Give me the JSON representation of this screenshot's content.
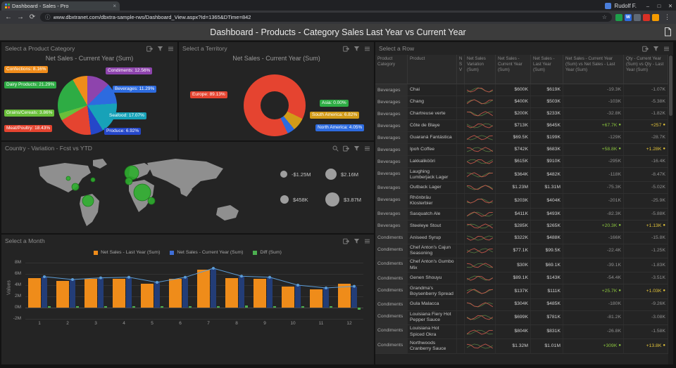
{
  "browser": {
    "tab": {
      "title": "Dashboard - Sales - Pro",
      "close": "×"
    },
    "user": "Rudolf F.",
    "window_controls": [
      "–",
      "□",
      "✕"
    ],
    "nav": {
      "back": "←",
      "forward": "→",
      "reload": "⟳"
    },
    "url": "www.dbxtranet.com/dbxtra-sample-rws/Dashboard_View.aspx?Id=1365&DTime=842",
    "url_info": "ⓘ",
    "star": "☆",
    "menu": "⋮",
    "extensions": [
      {
        "name": "green",
        "color": "#1e9e4a",
        "glyph": ""
      },
      {
        "name": "blue-w",
        "color": "#2d6bdf",
        "glyph": "W"
      },
      {
        "name": "slate",
        "color": "#5f6975",
        "glyph": ""
      },
      {
        "name": "red",
        "color": "#d93025",
        "glyph": ""
      },
      {
        "name": "orange",
        "color": "#f59b00",
        "glyph": ""
      }
    ]
  },
  "header": {
    "title": "Dashboard - Products - Category Sales Last Year vs Current Year"
  },
  "panels": {
    "category": {
      "title": "Select a Product Category",
      "chart_title": "Net Sales - Current Year (Sum)"
    },
    "territory": {
      "title": "Select a Territory",
      "chart_title": "Net Sales - Current Year (Sum)"
    },
    "map": {
      "title": "Country - Variation - Fcst vs YTD"
    },
    "month": {
      "title": "Select a Month"
    },
    "table": {
      "title": "Select a Row"
    }
  },
  "chart_data": [
    {
      "type": "pie",
      "title": "Net Sales - Current Year (Sum)",
      "slices": [
        {
          "name": "Condiments",
          "value": 12.56,
          "color": "#8e44ad"
        },
        {
          "name": "Beverages",
          "value": 11.29,
          "color": "#2d6bdf"
        },
        {
          "name": "Seafood",
          "value": 17.07,
          "color": "#17a2b8"
        },
        {
          "name": "Produce",
          "value": 6.92,
          "color": "#2547c9"
        },
        {
          "name": "Meat/Poultry",
          "value": 18.43,
          "color": "#e54430"
        },
        {
          "name": "Grains/Cereals",
          "value": 3.86,
          "color": "#6abf3a"
        },
        {
          "name": "Dairy Products",
          "value": 21.29,
          "color": "#2eac44"
        },
        {
          "name": "Confections",
          "value": 8.16,
          "color": "#ef8c1a"
        }
      ]
    },
    {
      "type": "pie",
      "subtype": "donut",
      "title": "Net Sales - Current Year (Sum)",
      "slices": [
        {
          "name": "Europe",
          "value": 89.13,
          "color": "#e54430"
        },
        {
          "name": "Asia",
          "value": 0.0,
          "color": "#2eac44"
        },
        {
          "name": "South America",
          "value": 6.82,
          "color": "#d29b18"
        },
        {
          "name": "North America",
          "value": 4.05,
          "color": "#2d6bdf"
        }
      ]
    },
    {
      "type": "scatter",
      "subtype": "bubble-map",
      "title": "Country - Variation - Fcst vs YTD",
      "legend": [
        {
          "label": "-$1.25M",
          "size": 10
        },
        {
          "label": "$2.16M",
          "size": 16
        },
        {
          "label": "$458K",
          "size": 12
        },
        {
          "label": "$3.87M",
          "size": 20
        }
      ],
      "bubbles": [
        {
          "x": 60,
          "y": 30,
          "r": 3
        },
        {
          "x": 70,
          "y": 42,
          "r": 5
        },
        {
          "x": 88,
          "y": 62,
          "r": 8
        },
        {
          "x": 150,
          "y": 22,
          "r": 10
        },
        {
          "x": 146,
          "y": 34,
          "r": 5
        },
        {
          "x": 165,
          "y": 50,
          "r": 12
        },
        {
          "x": 178,
          "y": 62,
          "r": 5
        },
        {
          "x": 95,
          "y": 32,
          "r": 3
        }
      ]
    },
    {
      "type": "bar",
      "categories": [
        "1",
        "2",
        "3",
        "4",
        "5",
        "6",
        "7",
        "8",
        "9",
        "10",
        "11",
        "12"
      ],
      "series": [
        {
          "name": "Net Sales - Last Year (Sum)",
          "color": "#ef8c1a",
          "values": [
            5.2,
            4.7,
            5.1,
            5.1,
            4.2,
            5.1,
            6.7,
            5.2,
            5.1,
            3.7,
            3.2,
            4.2
          ]
        },
        {
          "name": "Net Sales - Current Year (Sum)",
          "color": "#3f6fd8",
          "values": [
            5.5,
            5.0,
            5.3,
            5.4,
            4.5,
            5.4,
            7.0,
            5.6,
            5.4,
            4.0,
            3.5,
            3.8
          ]
        },
        {
          "name": "Diff (Sum)",
          "color": "#4caf50",
          "values": [
            0.3,
            0.3,
            0.2,
            0.3,
            0.3,
            0.3,
            0.3,
            0.4,
            0.3,
            0.3,
            0.3,
            -0.4
          ]
        }
      ],
      "ylabel": "Values",
      "yticks": [
        "8M",
        "6M",
        "4M",
        "2M",
        "0M",
        "-2M"
      ],
      "ylim": [
        -2,
        8
      ],
      "grid": true,
      "legend_position": "top"
    }
  ],
  "table": {
    "columns": [
      "Product Category",
      "Product",
      "N S V",
      "Net Sales Variation (Sum)",
      "Net Sales - Current Year (Sum)",
      "Net Sales - Last Year (Sum)",
      "Net Sales - Current Year (Sum) vs Net Sales - Last Year (Sum)",
      "Qty - Current Year (Sum) vs Qty - Last Year (Sum)"
    ],
    "rows": [
      {
        "category": "Beverages",
        "product": "Chai",
        "current": "$600K",
        "last": "$619K",
        "vs": "-19.3K",
        "qty": "-1.07K"
      },
      {
        "category": "Beverages",
        "product": "Chang",
        "current": "$400K",
        "last": "$503K",
        "vs": "-103K",
        "qty": "-5.38K"
      },
      {
        "category": "Beverages",
        "product": "Chartreuse verte",
        "current": "$200K",
        "last": "$233K",
        "vs": "-32.8K",
        "qty": "-1.82K"
      },
      {
        "category": "Beverages",
        "product": "Côte de Blaye",
        "current": "$713K",
        "last": "$645K",
        "vs": "+67.7K",
        "qty": "+257"
      },
      {
        "category": "Beverages",
        "product": "Guaraná Fantástica",
        "current": "$69.5K",
        "last": "$199K",
        "vs": "-129K",
        "qty": "-28.7K"
      },
      {
        "category": "Beverages",
        "product": "Ipoh Coffee",
        "current": "$742K",
        "last": "$683K",
        "vs": "+58.8K",
        "qty": "+1.28K"
      },
      {
        "category": "Beverages",
        "product": "Lakkalikööri",
        "current": "$615K",
        "last": "$910K",
        "vs": "-295K",
        "qty": "-16.4K"
      },
      {
        "category": "Beverages",
        "product": "Laughing Lumberjack Lager",
        "current": "$364K",
        "last": "$482K",
        "vs": "-118K",
        "qty": "-8.47K"
      },
      {
        "category": "Beverages",
        "product": "Outback Lager",
        "current": "$1.23M",
        "last": "$1.31M",
        "vs": "-75.3K",
        "qty": "-5.02K"
      },
      {
        "category": "Beverages",
        "product": "Rhönbräu Klosterbier",
        "current": "$203K",
        "last": "$404K",
        "vs": "-201K",
        "qty": "-25.9K"
      },
      {
        "category": "Beverages",
        "product": "Sasquatch Ale",
        "current": "$411K",
        "last": "$493K",
        "vs": "-82.3K",
        "qty": "-5.88K"
      },
      {
        "category": "Beverages",
        "product": "Steeleye Stout",
        "current": "$285K",
        "last": "$265K",
        "vs": "+20.3K",
        "qty": "+1.13K"
      },
      {
        "category": "Condiments",
        "product": "Aniseed Syrup",
        "current": "$322K",
        "last": "$488K",
        "vs": "-166K",
        "qty": "-15.8K"
      },
      {
        "category": "Condiments",
        "product": "Chef Anton's Cajun Seasoning",
        "current": "$77.1K",
        "last": "$99.5K",
        "vs": "-22.4K",
        "qty": "-1.25K"
      },
      {
        "category": "Condiments",
        "product": "Chef Anton's Gumbo Mix",
        "current": "$30K",
        "last": "$69.1K",
        "vs": "-39.1K",
        "qty": "-1.83K"
      },
      {
        "category": "Condiments",
        "product": "Genen Shouyu",
        "current": "$89.1K",
        "last": "$143K",
        "vs": "-54.4K",
        "qty": "-3.51K"
      },
      {
        "category": "Condiments",
        "product": "Grandma's Boysenberry Spread",
        "current": "$137K",
        "last": "$111K",
        "vs": "+25.7K",
        "qty": "+1.03K"
      },
      {
        "category": "Condiments",
        "product": "Gula Malacca",
        "current": "$304K",
        "last": "$485K",
        "vs": "-180K",
        "qty": "-9.26K"
      },
      {
        "category": "Condiments",
        "product": "Louisiana Fiery Hot Pepper Sauce",
        "current": "$699K",
        "last": "$781K",
        "vs": "-81.2K",
        "qty": "-3.08K"
      },
      {
        "category": "Condiments",
        "product": "Louisiana Hot Spiced Okra",
        "current": "$804K",
        "last": "$831K",
        "vs": "-26.8K",
        "qty": "-1.58K"
      },
      {
        "category": "Condiments",
        "product": "Northwoods Cranberry Sauce",
        "current": "$1.32M",
        "last": "$1.01M",
        "vs": "+309K",
        "qty": "+13.8K"
      }
    ]
  }
}
